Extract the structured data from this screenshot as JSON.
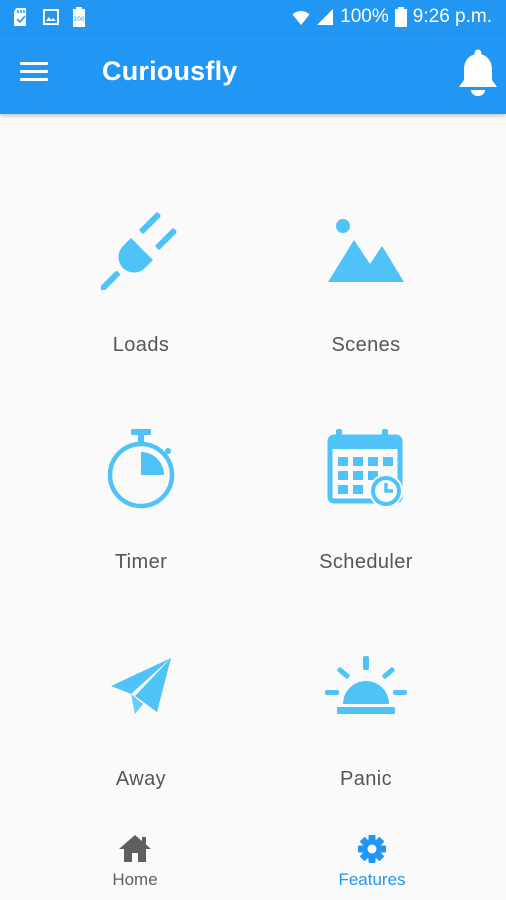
{
  "status_bar": {
    "battery": "100%",
    "time": "9:26 p.m.",
    "icons": [
      "sd-card-icon",
      "image-icon",
      "battery-small-icon",
      "wifi-icon",
      "signal-icon",
      "battery-icon"
    ]
  },
  "app_bar": {
    "title": "Curiousfly",
    "menu_icon": "menu-icon",
    "notification_icon": "bell-icon"
  },
  "features": [
    {
      "label": "Loads",
      "icon": "plug-icon"
    },
    {
      "label": "Scenes",
      "icon": "landscape-icon"
    },
    {
      "label": "Timer",
      "icon": "stopwatch-icon"
    },
    {
      "label": "Scheduler",
      "icon": "calendar-clock-icon"
    },
    {
      "label": "Away",
      "icon": "paper-plane-icon"
    },
    {
      "label": "Panic",
      "icon": "alarm-light-icon"
    }
  ],
  "bottom_nav": {
    "items": [
      {
        "label": "Home",
        "icon": "home-icon",
        "active": false
      },
      {
        "label": "Features",
        "icon": "gear-icon",
        "active": true
      }
    ]
  },
  "colors": {
    "primary": "#2196f3",
    "icon": "#4fc3f7",
    "label": "#555555",
    "nav_inactive": "#5f5f5f",
    "nav_active": "#2196f3"
  }
}
